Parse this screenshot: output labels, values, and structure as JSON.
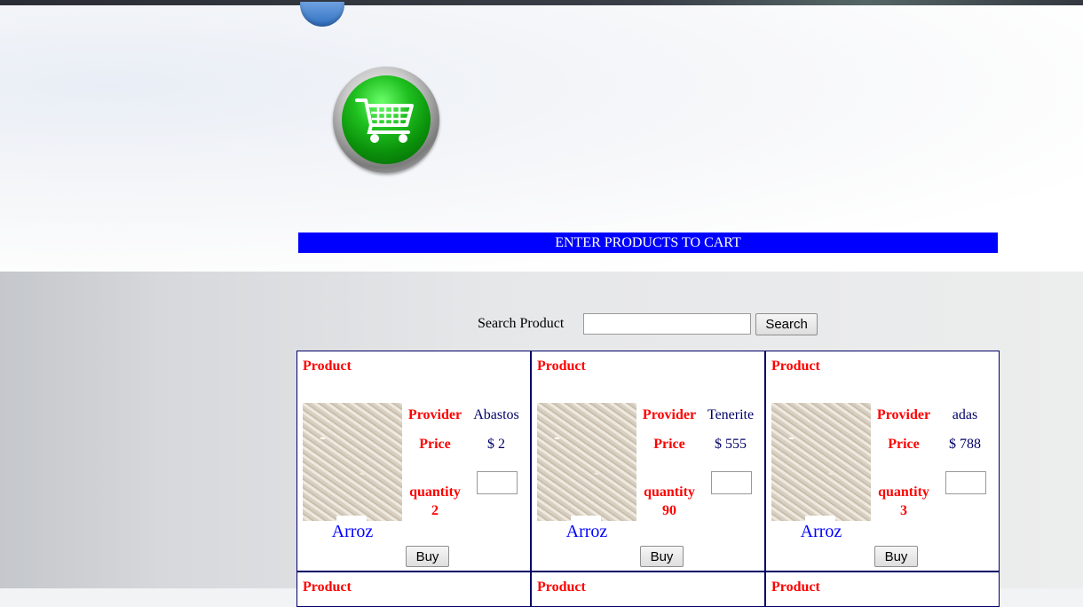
{
  "banner": {
    "text": "ENTER PRODUCTS TO CART",
    "color": "#0000ff"
  },
  "search": {
    "label": "Search Product",
    "value": "",
    "button": "Search"
  },
  "products": [
    {
      "title": "Product",
      "name": "Arroz",
      "provider_label": "Provider",
      "provider": "Abastos",
      "price_label": "Price",
      "price": "$ 2",
      "quantity_label": "quantity",
      "quantity": "2",
      "qty_value": "",
      "buy": "Buy"
    },
    {
      "title": "Product",
      "name": "Arroz",
      "provider_label": "Provider",
      "provider": "Tenerite",
      "price_label": "Price",
      "price": "$ 555",
      "quantity_label": "quantity",
      "quantity": "90",
      "qty_value": "",
      "buy": "Buy"
    },
    {
      "title": "Product",
      "name": "Arroz",
      "provider_label": "Provider",
      "provider": "adas",
      "price_label": "Price",
      "price": "$ 788",
      "quantity_label": "quantity",
      "quantity": "3",
      "qty_value": "",
      "buy": "Buy"
    }
  ],
  "next_row": [
    {
      "title": "Product"
    },
    {
      "title": "Product"
    },
    {
      "title": "Product"
    }
  ],
  "icons": {
    "logo": "shopping-cart-icon"
  },
  "colors": {
    "label": "#ff0000",
    "value": "#000066",
    "name": "#0000ff"
  }
}
